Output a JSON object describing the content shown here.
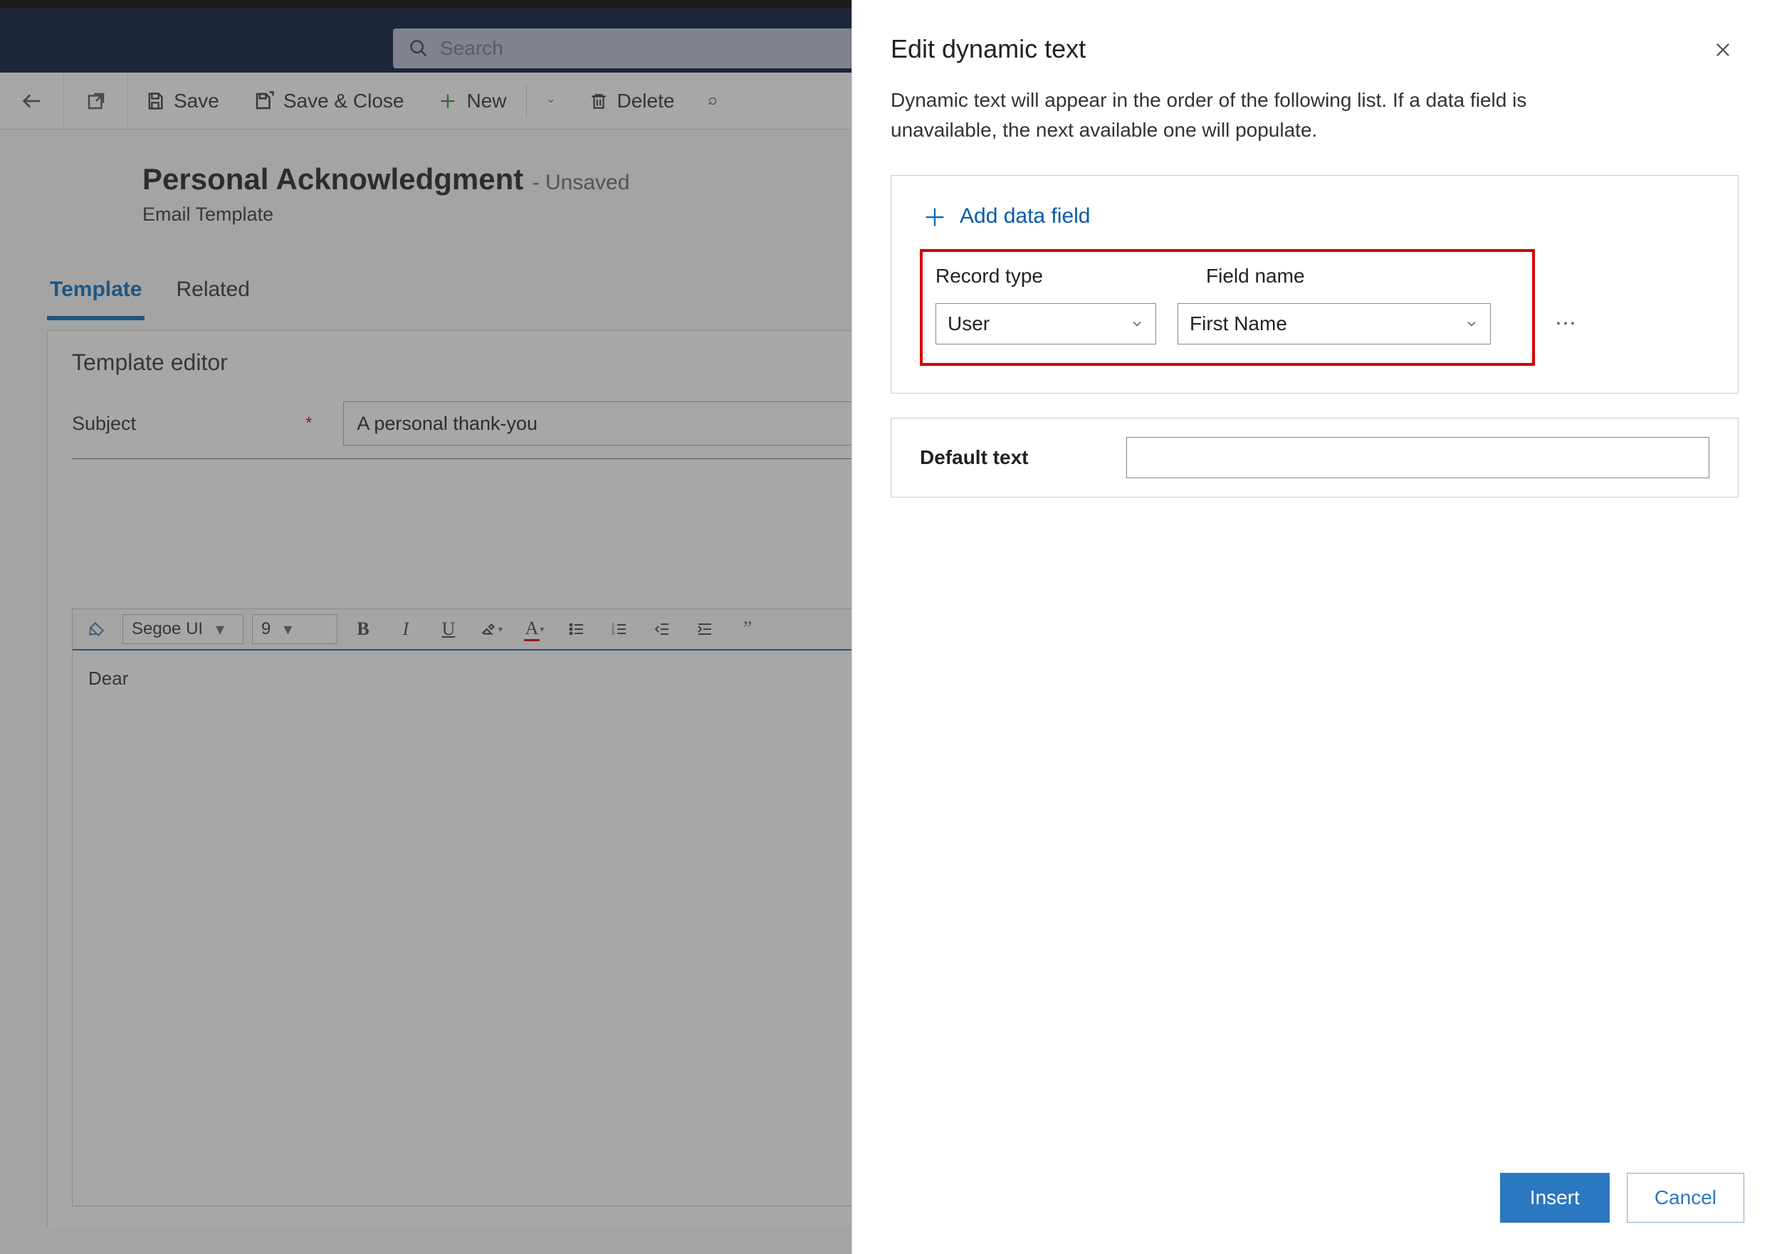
{
  "search": {
    "placeholder": "Search"
  },
  "commandbar": {
    "save": "Save",
    "save_close": "Save & Close",
    "new": "New",
    "delete": "Delete"
  },
  "page": {
    "title": "Personal Acknowledgment",
    "status": "- Unsaved",
    "subtitle": "Email Template"
  },
  "tabs": {
    "template": "Template",
    "related": "Related"
  },
  "editor": {
    "section_title": "Template editor",
    "subject_label": "Subject",
    "subject_value": "A personal thank-you",
    "font_family": "Segoe UI",
    "font_size": "9",
    "body_text": "Dear"
  },
  "panel": {
    "title": "Edit dynamic text",
    "description": "Dynamic text will appear in the order of the following list. If a data field is unavailable, the next available one will populate.",
    "add_field": "Add data field",
    "col_record_type": "Record type",
    "col_field_name": "Field name",
    "record_type_value": "User",
    "field_name_value": "First Name",
    "default_label": "Default text",
    "default_value": "",
    "insert": "Insert",
    "cancel": "Cancel"
  }
}
